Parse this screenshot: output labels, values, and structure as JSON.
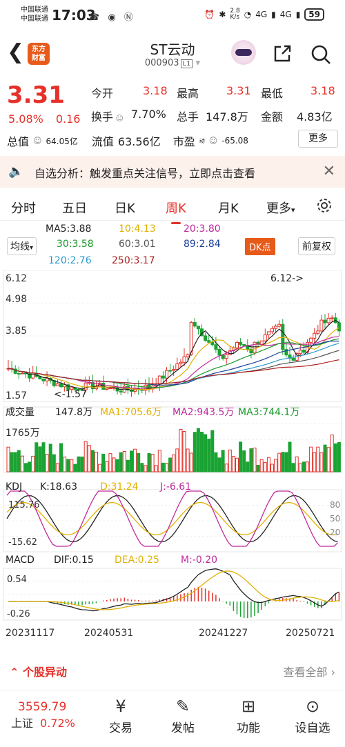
{
  "status": {
    "carrier1": "中国联通",
    "carrier2": "中国联通",
    "time": "17:03",
    "speed": "2.8\nK/s",
    "signal": "4G",
    "battery": "59"
  },
  "header": {
    "name": "ST云动",
    "code": "000903",
    "level": "L1",
    "logo": "东方\n财富"
  },
  "quote": {
    "price": "3.31",
    "pct": "5.08%",
    "chg": "0.16",
    "open_label": "今开",
    "open": "3.18",
    "high_label": "最高",
    "high": "3.31",
    "low_label": "最低",
    "low": "3.18",
    "turn_label": "换手",
    "turn": "7.70%",
    "vol_label": "总手",
    "vol": "147.8万",
    "amt_label": "金额",
    "amt": "4.83亿",
    "mcap_label": "总值",
    "mcap": "64.05亿",
    "float_label": "流值",
    "float": "63.56亿",
    "pe_label": "市盈",
    "pe": "-65.08",
    "pe_sup": "动",
    "more": "更多"
  },
  "alert": {
    "text": "自选分析：触发重点关注信号，立即点击查看"
  },
  "tabs": [
    "分时",
    "五日",
    "日K",
    "周K",
    "月K",
    "更多"
  ],
  "ma": {
    "mode": "均线",
    "ma5": "MA5:3.88",
    "ma10": "10:4.13",
    "ma20": "20:3.80",
    "ma30": "30:3.58",
    "ma60": "60:3.01",
    "ma89": "89:2.84",
    "ma120": "120:2.76",
    "ma250": "250:3.17",
    "dk": "DK点",
    "fq": "前复权"
  },
  "chart_labels": {
    "p_hi": "6.12",
    "p_mid1": "4.98",
    "p_mid2": "3.85",
    "p_low": "1.57",
    "peak": "6.12->",
    "trough": "<-1.57",
    "vol_title": "成交量",
    "vol_total": "147.8万",
    "vol_ma1": "MA1:705.6万",
    "vol_ma2": "MA2:943.5万",
    "vol_ma3": "MA3:744.1万",
    "vol_axis": "1765万",
    "kdj": "KDJ",
    "k": "K:18.63",
    "d": "D:31.24",
    "j": "J:-6.61",
    "kdj_hi": "115.76",
    "kdj_lo": "-15.62",
    "kdj_80": "80",
    "kdj_50": "50",
    "kdj_20": "20",
    "macd": "MACD",
    "dif": "DIF:0.15",
    "dea": "DEA:0.25",
    "m": "M:-0.20",
    "macd_hi": "0.54",
    "macd_lo": "-0.26",
    "d1": "20231117",
    "d2": "20240531",
    "d3": "20241227",
    "d4": "20250721"
  },
  "movers": {
    "title": "个股异动",
    "more": "查看全部"
  },
  "nav": {
    "idx_val": "3559.79",
    "idx_name": "上证",
    "idx_pct": "0.72%",
    "trade": "交易",
    "post": "发帖",
    "func": "功能",
    "watch": "设自选"
  },
  "colors": {
    "up": "#e5312a",
    "down": "#1aa333",
    "ma5": "#222",
    "ma10": "#e0b000",
    "ma20": "#c0299c",
    "ma30": "#1a9a2a",
    "ma60": "#555",
    "ma89": "#1a3f9a",
    "ma120": "#2a9ad0",
    "ma250": "#b02020"
  }
}
